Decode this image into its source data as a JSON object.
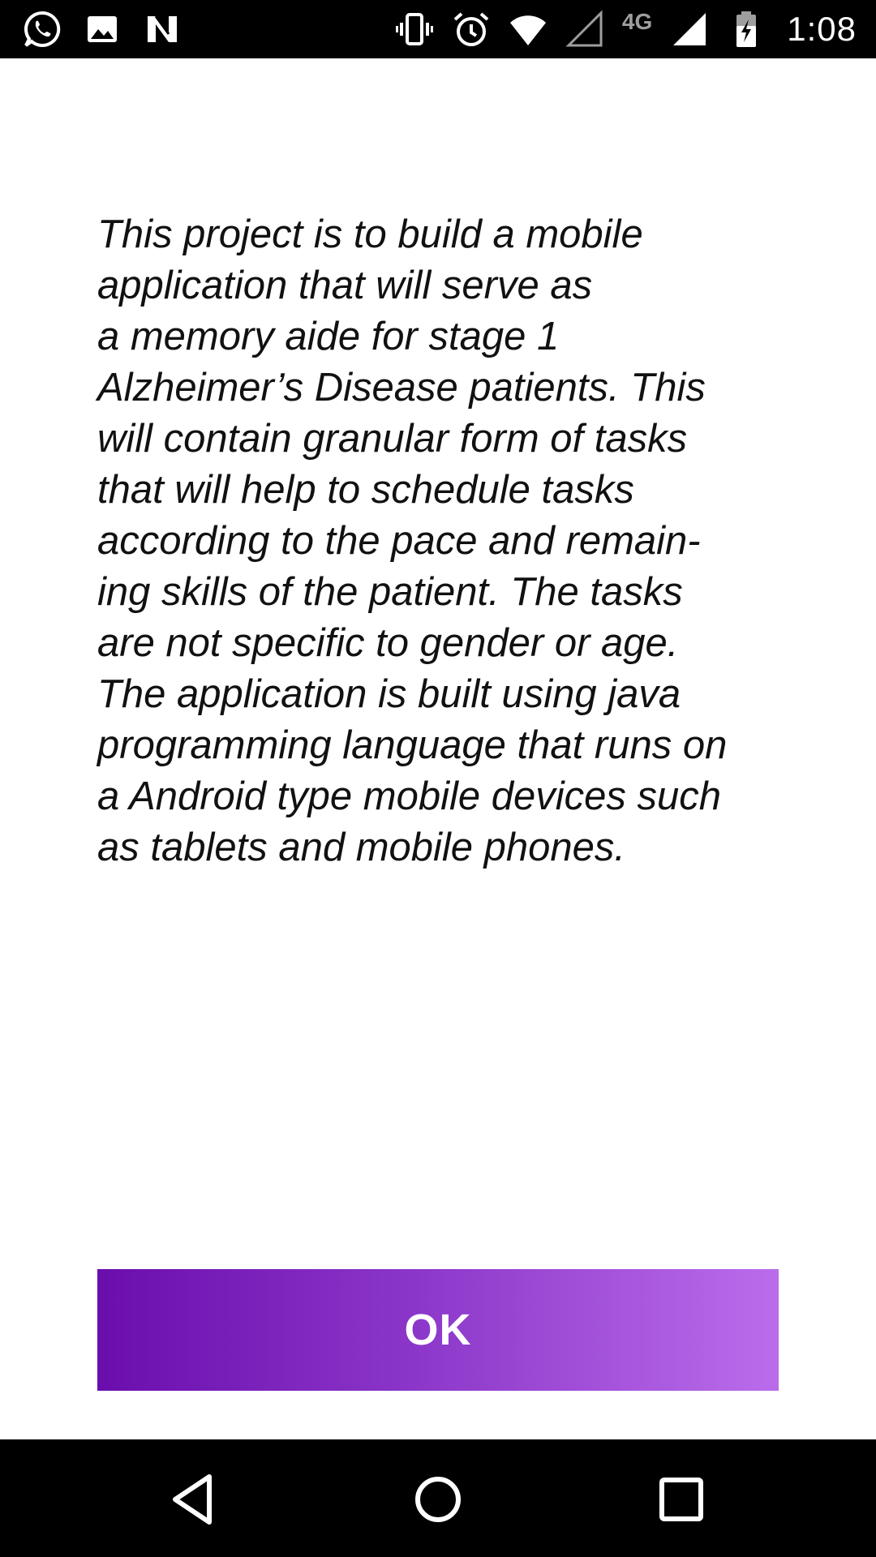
{
  "status_bar": {
    "left_icons": [
      "whatsapp-icon",
      "gallery-icon",
      "nfc-n-icon"
    ],
    "right_icons": [
      "vibrate-icon",
      "alarm-icon",
      "wifi-icon",
      "signal-empty-icon",
      "signal-icon",
      "battery-charging-icon"
    ],
    "network_label": "4G",
    "time": "1:08"
  },
  "dialog": {
    "description": "This project is to build a mobile\napplication that will serve as\na memory aide for stage 1\nAlzheimer’s Disease patients. This\nwill contain granular form of tasks\nthat will help to schedule tasks\naccording to the pace and remain-\ning skills of the patient. The tasks\nare not specific to gender or age.\nThe application is built using java\nprogramming language that runs on\na Android type mobile devices such\nas tablets and mobile phones.",
    "ok_label": "OK"
  },
  "colors": {
    "button_gradient_start": "#6a0dad",
    "button_gradient_end": "#bb6ceb",
    "background": "#ffffff",
    "system_bars": "#000000"
  },
  "nav_bar": {
    "buttons": [
      "back-icon",
      "home-icon",
      "recents-icon"
    ]
  }
}
